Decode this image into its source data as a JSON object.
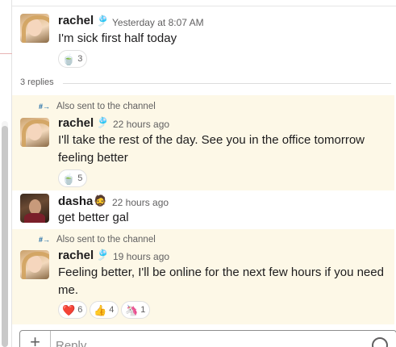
{
  "parent": {
    "author": "rachel",
    "status_emoji": "🎐",
    "time": "Yesterday at 8:07 AM",
    "text": "I'm sick first half today",
    "reactions": [
      {
        "emoji": "🍵",
        "count": "3"
      }
    ]
  },
  "replies_label": "3 replies",
  "replies": [
    {
      "sent_note": "Also sent to the channel",
      "author": "rachel",
      "status_emoji": "🎐",
      "time": "22 hours ago",
      "text": "I'll take the rest of the day. See you in the office tomorrow feeling better",
      "reactions": [
        {
          "emoji": "🍵",
          "count": "5"
        }
      ]
    },
    {
      "author": "dasha",
      "status_emoji": "🧔",
      "time": "22 hours ago",
      "text": "get better gal"
    },
    {
      "sent_note": "Also sent to the channel",
      "author": "rachel",
      "status_emoji": "🎐",
      "time": "19 hours ago",
      "text": "Feeling better, I'll be online for the next few hours if you need me.",
      "reactions": [
        {
          "emoji": "❤️",
          "count": "6"
        },
        {
          "emoji": "👍",
          "count": "4"
        },
        {
          "emoji": "🦄",
          "count": "1"
        }
      ]
    }
  ],
  "composer": {
    "placeholder": "Reply..."
  },
  "icons": {
    "channel_share": "hash-arrow-icon",
    "attach": "plus-icon",
    "emoji_picker": "smile-icon"
  },
  "colors": {
    "highlight_bg": "#fdf8e7",
    "link_blue": "#1264a3",
    "muted_text": "#616061"
  }
}
